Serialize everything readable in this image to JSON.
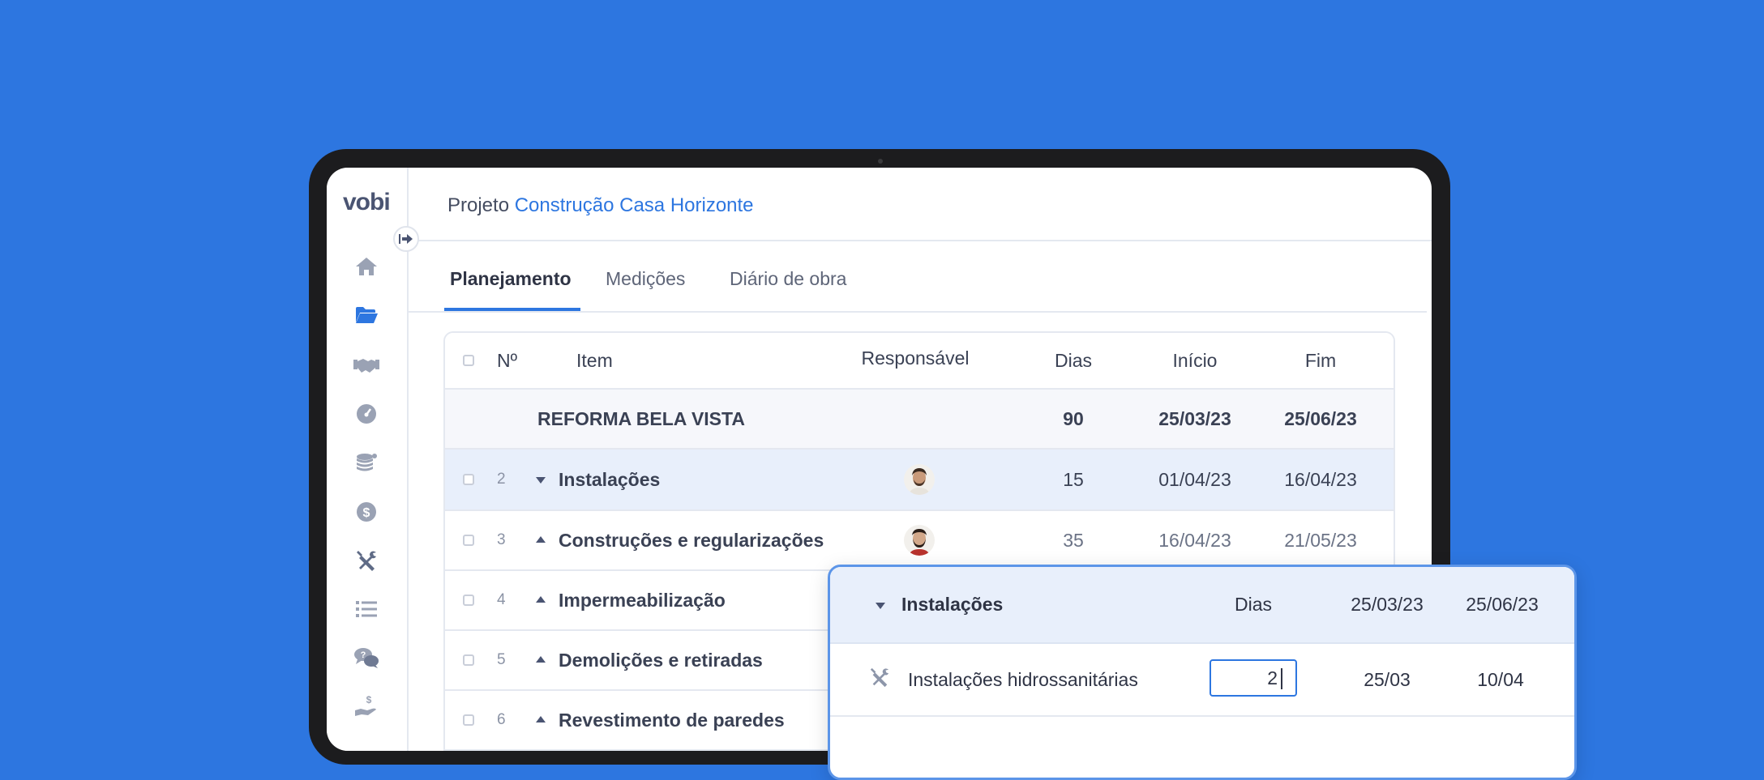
{
  "app": {
    "logo": "vobi"
  },
  "header": {
    "project_label": "Projeto",
    "project_name": "Construção Casa Horizonte"
  },
  "tabs": [
    {
      "label": "Planejamento",
      "active": true
    },
    {
      "label": "Medições"
    },
    {
      "label": "Diário de obra"
    }
  ],
  "sidebar": {
    "icons": [
      "collapse-arrow-icon",
      "home-icon",
      "folder-icon",
      "handshake-icon",
      "gauge-icon",
      "coins-icon",
      "dollar-icon",
      "tools-icon",
      "list-icon",
      "chat-icon",
      "hand-money-icon"
    ]
  },
  "table": {
    "columns": {
      "num": "Nº",
      "item": "Item",
      "responsible": "Responsável",
      "days": "Dias",
      "start": "Início",
      "end": "Fim"
    },
    "summary": {
      "name": "REFORMA BELA VISTA",
      "days": "90",
      "start": "25/03/23",
      "end": "25/06/23"
    },
    "rows": [
      {
        "num": "2",
        "name": "Instalações",
        "days": "15",
        "start": "01/04/23",
        "end": "16/04/23",
        "expanded": true,
        "selected": true
      },
      {
        "num": "3",
        "name": "Construções e regularizações",
        "days": "35",
        "start": "16/04/23",
        "end": "21/05/23"
      },
      {
        "num": "4",
        "name": "Impermeabilização"
      },
      {
        "num": "5",
        "name": "Demolições e retiradas"
      },
      {
        "num": "6",
        "name": "Revestimento de paredes"
      }
    ]
  },
  "popup": {
    "title": "Instalações",
    "days_label": "Dias",
    "start": "25/03/23",
    "end": "25/06/23",
    "row": {
      "name": "Instalações hidrossanitárias",
      "days_value": "2",
      "start": "25/03",
      "end": "10/04"
    }
  },
  "colors": {
    "background": "#2D76E0",
    "accent": "#2D76E0",
    "selected_row": "#E8EFFB"
  }
}
